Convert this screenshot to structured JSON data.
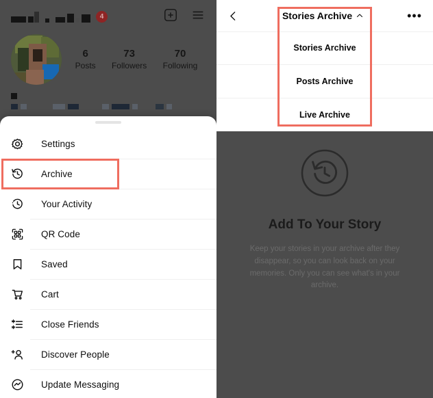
{
  "profile": {
    "badge_count": "4",
    "username_redacted": true,
    "stats": [
      {
        "number": "6",
        "label": "Posts"
      },
      {
        "number": "73",
        "label": "Followers"
      },
      {
        "number": "70",
        "label": "Following"
      }
    ],
    "icons": {
      "add_post": "plus-square-icon",
      "menu": "hamburger-icon"
    }
  },
  "sheet": {
    "handle": "drag-handle",
    "items": [
      {
        "label": "Settings",
        "icon": "gear-icon",
        "highlighted": false
      },
      {
        "label": "Archive",
        "icon": "archive-clock-icon",
        "highlighted": true
      },
      {
        "label": "Your Activity",
        "icon": "activity-clock-icon",
        "highlighted": false
      },
      {
        "label": "QR Code",
        "icon": "qr-code-icon",
        "highlighted": false
      },
      {
        "label": "Saved",
        "icon": "bookmark-icon",
        "highlighted": false
      },
      {
        "label": "Cart",
        "icon": "shopping-cart-icon",
        "highlighted": false
      },
      {
        "label": "Close Friends",
        "icon": "close-friends-list-icon",
        "highlighted": false
      },
      {
        "label": "Discover People",
        "icon": "add-person-icon",
        "highlighted": false
      },
      {
        "label": "Update Messaging",
        "icon": "messenger-icon",
        "highlighted": false
      }
    ]
  },
  "archive": {
    "header": {
      "back_icon": "chevron-left-icon",
      "title": "Stories Archive",
      "chevron_icon": "chevron-up-icon",
      "more_icon": "ellipsis-icon",
      "more_glyph": "•••"
    },
    "dropdown_options": [
      {
        "label": "Stories Archive"
      },
      {
        "label": "Posts Archive"
      },
      {
        "label": "Live Archive"
      }
    ],
    "empty_state": {
      "icon": "archive-clock-circle-icon",
      "title": "Add To Your Story",
      "description": "Keep your stories in your archive after they disappear, so you can look back on your memories. Only you can see what's in your archive."
    }
  },
  "annotations": {
    "highlight_color": "#ef6d5f",
    "overlay_color": "#4c4c4c"
  }
}
